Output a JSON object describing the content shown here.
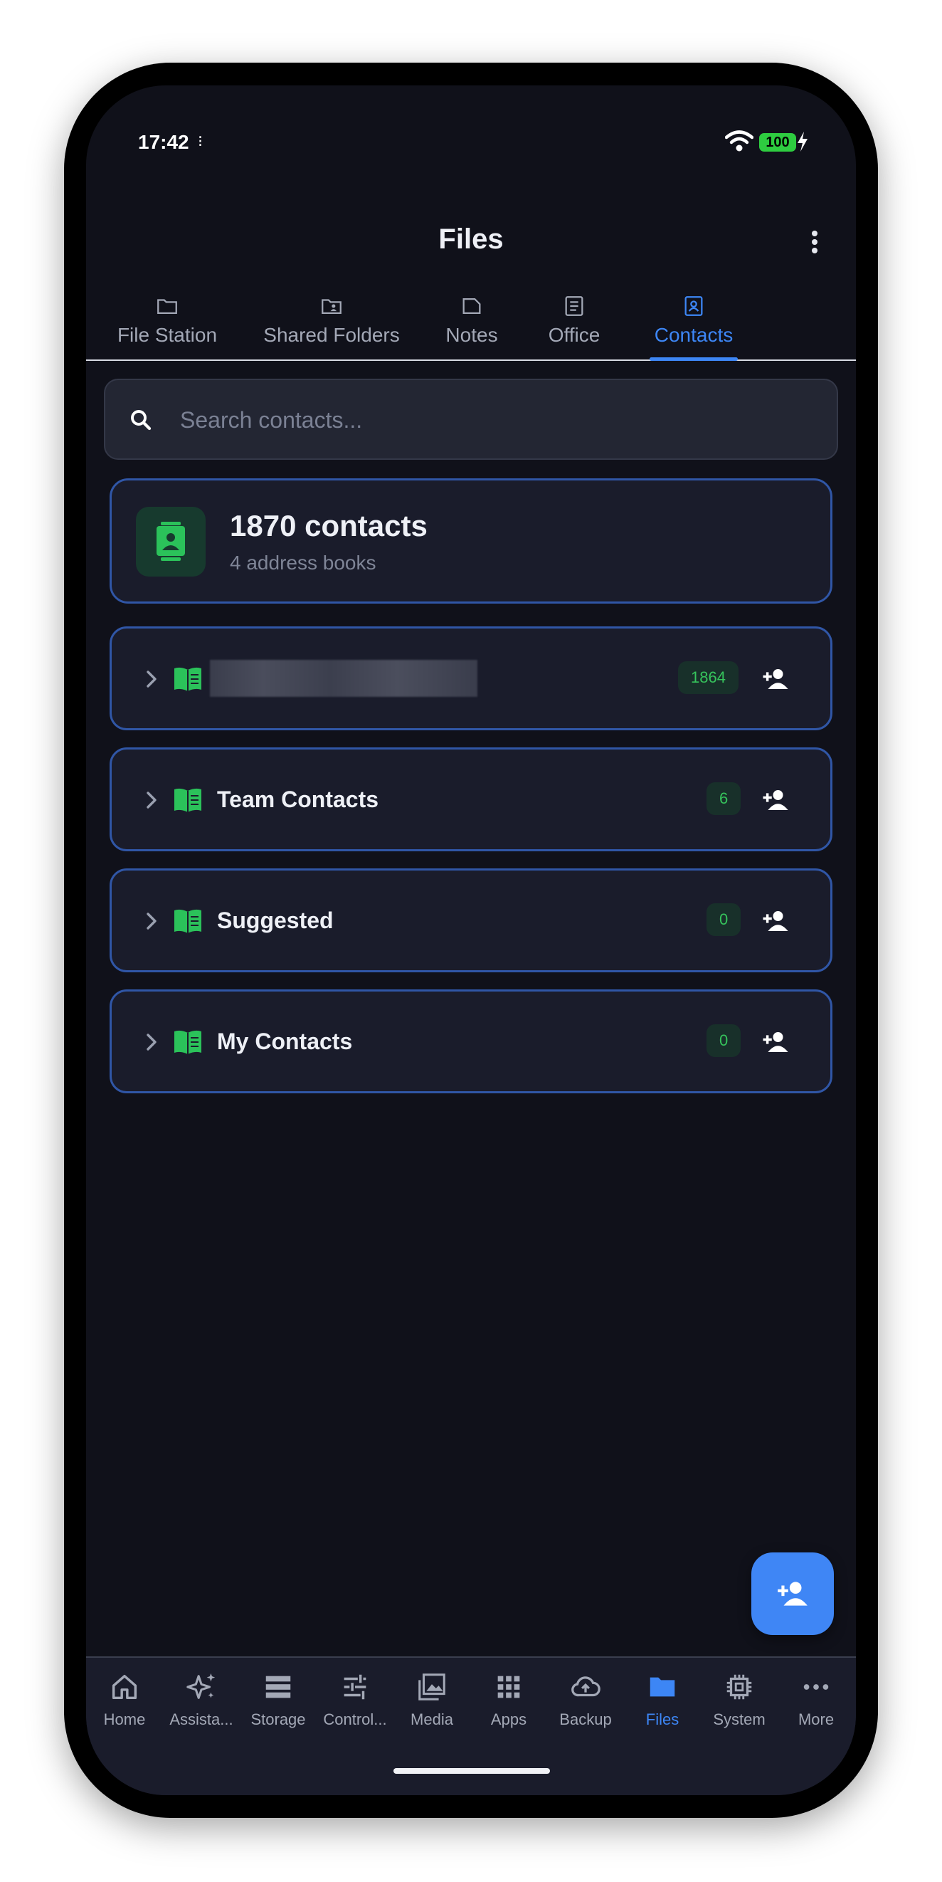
{
  "status_bar": {
    "time": "17:42",
    "indicator": "⁝",
    "battery": "100"
  },
  "header": {
    "title": "Files",
    "menu_icon": "more-vert-icon"
  },
  "tabs": [
    {
      "label": "File Station",
      "icon": "folder-icon"
    },
    {
      "label": "Shared Folders",
      "icon": "shared-folder-icon"
    },
    {
      "label": "Notes",
      "icon": "note-icon"
    },
    {
      "label": "Office",
      "icon": "document-icon"
    },
    {
      "label": "Contacts",
      "icon": "contacts-icon",
      "active": true
    }
  ],
  "search": {
    "placeholder": "Search contacts..."
  },
  "summary": {
    "count": "1870 contacts",
    "subtitle": "4 address books"
  },
  "address_books": [
    {
      "name": "",
      "redacted": true,
      "count": "1864"
    },
    {
      "name": "Team Contacts",
      "count": "6"
    },
    {
      "name": "Suggested",
      "count": "0"
    },
    {
      "name": "My Contacts",
      "count": "0"
    }
  ],
  "fab": {
    "icon": "person-add-icon"
  },
  "bottom_nav": [
    {
      "label": "Home",
      "icon": "home-icon"
    },
    {
      "label": "Assista...",
      "icon": "sparkle-icon"
    },
    {
      "label": "Storage",
      "icon": "storage-icon"
    },
    {
      "label": "Control...",
      "icon": "sliders-icon"
    },
    {
      "label": "Media",
      "icon": "photo-library-icon"
    },
    {
      "label": "Apps",
      "icon": "apps-grid-icon"
    },
    {
      "label": "Backup",
      "icon": "cloud-upload-icon"
    },
    {
      "label": "Files",
      "icon": "folder-filled-icon",
      "active": true
    },
    {
      "label": "System",
      "icon": "cpu-icon"
    },
    {
      "label": "More",
      "icon": "more-horiz-icon"
    }
  ],
  "colors": {
    "background": "#10111a",
    "card": "#1a1c2b",
    "card_border": "#3056a6",
    "accent": "#3d86f5",
    "green": "#36c45c",
    "muted_text": "#a3a8b6"
  }
}
